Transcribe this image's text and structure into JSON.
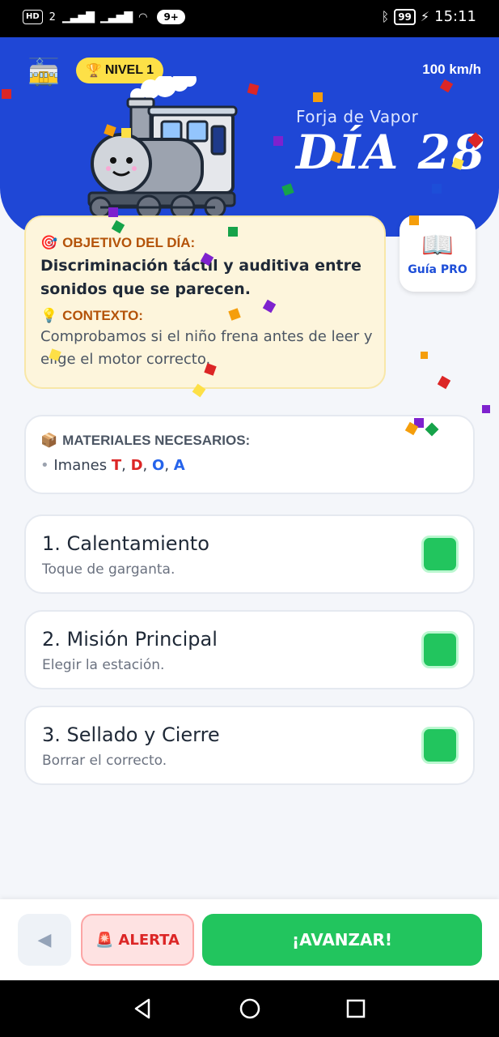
{
  "status_bar": {
    "network": "HD",
    "sim": "2",
    "notification_count": "9+",
    "battery": "99",
    "time": "15:11"
  },
  "header": {
    "level": "NIVEL 1",
    "speed": "100 km/h",
    "world": "Forja de Vapor",
    "day": "DÍA 28"
  },
  "objective": {
    "label": "OBJETIVO DEL DÍA:",
    "text": "Discriminación táctil y auditiva entre sonidos que se parecen.",
    "context_label": "CONTEXTO:",
    "context_text": "Comprobamos si el niño frena antes de leer y elige el motor correcto."
  },
  "guide": {
    "label": "Guía PRO"
  },
  "materials": {
    "label": "MATERIALES NECESARIOS:",
    "bullet": "•",
    "prefix": "Imanes",
    "letters": [
      "T",
      "D",
      "O",
      "A"
    ],
    "separator": ","
  },
  "steps": [
    {
      "title": "1. Calentamiento",
      "subtitle": "Toque de garganta.",
      "completed": true
    },
    {
      "title": "2. Misión Principal",
      "subtitle": "Elegir la estación.",
      "completed": true
    },
    {
      "title": "3. Sellado y Cierre",
      "subtitle": "Borrar el correcto.",
      "completed": true
    }
  ],
  "actions": {
    "back_symbol": "◀",
    "alert": "ALERTA",
    "advance": "¡AVANZAR!"
  },
  "icons": {
    "tram": "tram-icon",
    "trophy": "trophy-icon",
    "target": "target-icon",
    "bulb": "lightbulb-icon",
    "book": "book-icon",
    "package": "package-icon",
    "siren": "siren-icon"
  },
  "colors": {
    "header_blue": "#1f47d6",
    "success_green": "#22c55e",
    "alert_red": "#dc2626",
    "badge_yellow": "#fde047",
    "objective_bg": "#fdf5dc"
  }
}
